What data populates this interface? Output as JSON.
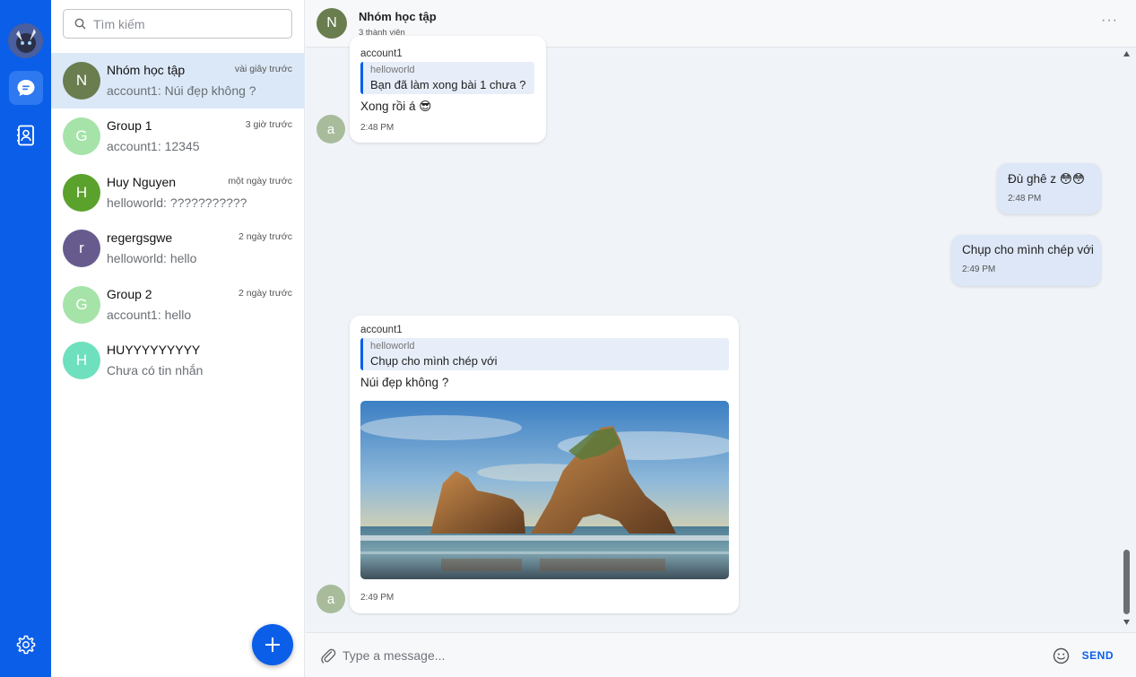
{
  "app": {
    "accent": "#0b5ee8"
  },
  "search": {
    "placeholder": "Tìm kiếm"
  },
  "conversations": [
    {
      "initial": "N",
      "name": "Nhóm học tập",
      "time": "vài giây trước",
      "preview": "account1: Núi đẹp không ?",
      "color": "#6a7d4f",
      "active": true
    },
    {
      "initial": "G",
      "name": "Group 1",
      "time": "3 giờ trước",
      "preview": "account1: 12345",
      "color": "#a6e3a9",
      "active": false
    },
    {
      "initial": "H",
      "name": "Huy Nguyen",
      "time": "một ngày trước",
      "preview": "helloworld: ???????????",
      "color": "#5aa22c",
      "active": false
    },
    {
      "initial": "r",
      "name": "regergsgwe",
      "time": "2 ngày trước",
      "preview": "helloworld: hello",
      "color": "#675b8e",
      "active": false
    },
    {
      "initial": "G",
      "name": "Group 2",
      "time": "2 ngày trước",
      "preview": "account1: hello",
      "color": "#a6e3a9",
      "active": false
    },
    {
      "initial": "H",
      "name": "HUYYYYYYYYY",
      "time": "",
      "preview": "Chưa có tin nhắn",
      "color": "#6ee0bd",
      "active": false
    }
  ],
  "chat": {
    "initial": "N",
    "title": "Nhóm học tập",
    "members": "3 thành viên",
    "more": "···",
    "messages": [
      {
        "sender": "account1",
        "avatar": "a",
        "quote_name": "helloworld",
        "quote_text": "Bạn đã làm xong bài 1 chưa ?",
        "text": "Xong rồi á 😎",
        "time": "2:48 PM"
      },
      {
        "text": "Đù ghê z 😳😳",
        "time": "2:48 PM",
        "mine": true
      },
      {
        "text": "Chụp cho mình chép với",
        "time": "2:49 PM",
        "mine": true
      },
      {
        "sender": "account1",
        "avatar": "a",
        "quote_name": "helloworld",
        "quote_text": "Chụp cho mình chép với",
        "text": "Núi đẹp không ?",
        "time": "2:49 PM",
        "has_image": true
      }
    ]
  },
  "composer": {
    "placeholder": "Type a message...",
    "send_label": "SEND"
  }
}
